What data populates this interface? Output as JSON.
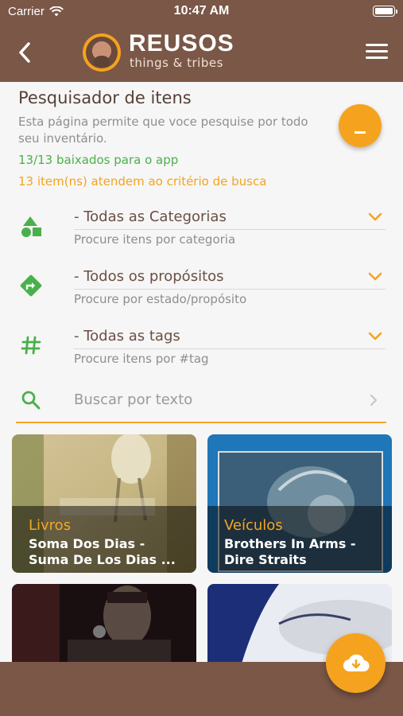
{
  "status_bar": {
    "carrier": "Carrier",
    "time": "10:47 AM"
  },
  "header": {
    "brand_title": "REUSOS",
    "brand_subtitle": "things & tribes"
  },
  "intro": {
    "title": "Pesquisador de itens",
    "description": "Esta página permite que voce pesquise por todo seu inventário.",
    "downloaded": "13/13 baixados para o app",
    "matching": "13 item(ns) atendem ao critério de busca"
  },
  "filters": [
    {
      "value": "- Todas as Categorias",
      "hint": "Procure itens por categoria",
      "icon": "shapes-icon"
    },
    {
      "value": "- Todos os propósitos",
      "hint": "Procure por estado/propósito",
      "icon": "direction-icon"
    },
    {
      "value": "- Todas as tags",
      "hint": "Procure itens por #tag",
      "icon": "hashtag-icon"
    }
  ],
  "search": {
    "placeholder": "Buscar por texto"
  },
  "items": [
    {
      "category": "Livros",
      "title_line1": "Soma Dos Dias -",
      "title_line2": "Suma De Los Dias ..."
    },
    {
      "category": "Veículos",
      "title_line1": "Brothers In Arms -",
      "title_line2": "Dire Straits"
    },
    {
      "category": "",
      "title_line1": "",
      "title_line2": ""
    },
    {
      "category": "",
      "title_line1": "",
      "title_line2": ""
    }
  ],
  "colors": {
    "brand_brown": "#7a5747",
    "accent_orange": "#f5a31f",
    "green": "#4ab04b"
  }
}
